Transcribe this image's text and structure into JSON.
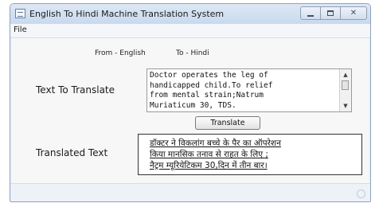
{
  "window": {
    "title": "English To Hindi Machine Translation System",
    "controls": {
      "minimize": "minimize",
      "maximize": "maximize",
      "close": "✕"
    }
  },
  "menu": {
    "file": "File"
  },
  "languages": {
    "from": "From - English",
    "to": "To - Hindi"
  },
  "labels": {
    "text_to_translate": "Text To Translate",
    "translated_text": "Translated Text"
  },
  "input": {
    "text": "Doctor operates the leg of\nhandicapped child.To relief\nfrom mental strain;Natrum\nMuriaticum 30, TDS."
  },
  "translate_button": "Translate",
  "output": {
    "text": "डॉक्टर ने विकलांग बच्चे के पैर का ऑपरेशन\nकिया मानसिक तनाव से राहत के लिए ;\nनैट्रम म्यूरियेटिकम 30,दिन में तीन बार।"
  },
  "icons": [
    "app-icon",
    "minimize-icon",
    "maximize-icon",
    "close-icon",
    "scroll-up-icon",
    "scroll-down-icon",
    "resize-grip-icon"
  ]
}
